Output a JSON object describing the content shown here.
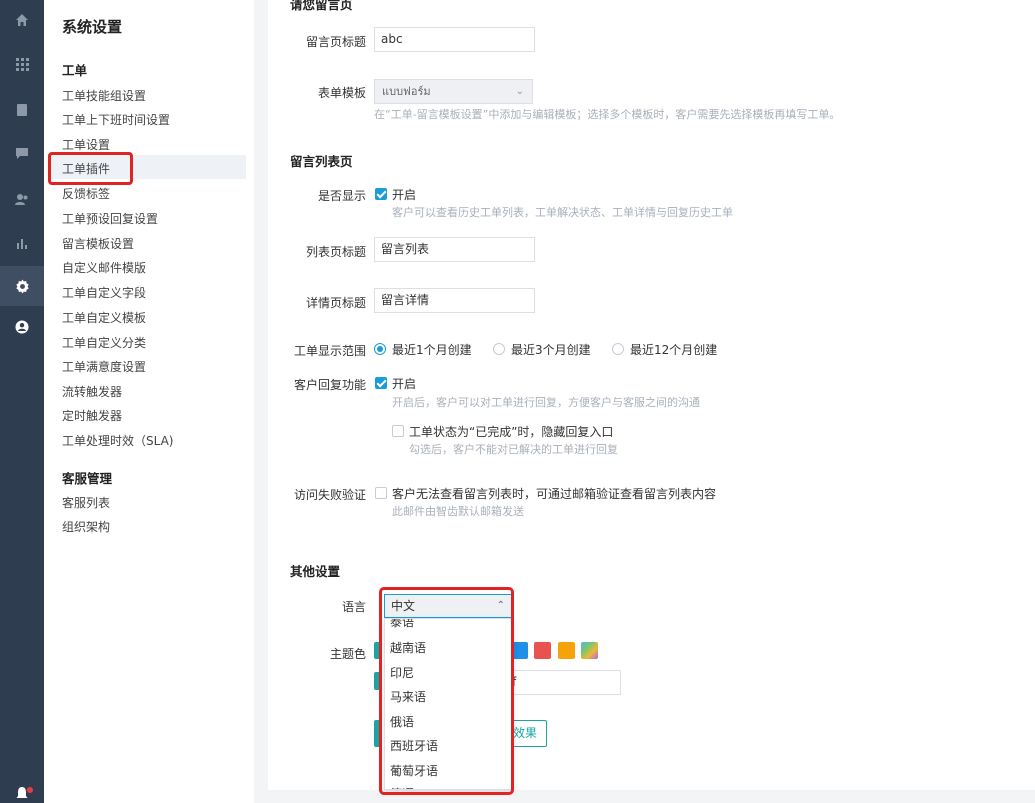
{
  "rail": {
    "icons": [
      "home-icon",
      "grid-icon",
      "document-icon",
      "chat-icon",
      "users-icon",
      "bar-chart-icon",
      "settings-icon",
      "account-icon"
    ],
    "active": "settings-icon"
  },
  "sidebar": {
    "title": "系统设置",
    "groups": [
      {
        "label": "工单",
        "items": [
          "工单技能组设置",
          "工单上下班时间设置",
          "工单设置",
          "工单插件",
          "反馈标签",
          "工单预设回复设置",
          "留言模板设置",
          "自定义邮件模版",
          "工单自定义字段",
          "工单自定义模板",
          "工单自定义分类",
          "工单满意度设置",
          "流转触发器",
          "定时触发器",
          "工单处理时效（SLA)"
        ]
      },
      {
        "label": "客服管理",
        "items": [
          "客服列表",
          "组织架构"
        ]
      }
    ],
    "active_item": "工单插件"
  },
  "page": {
    "section_top": "请您留言页",
    "title_label": "留言页标题",
    "title_value": "abc",
    "template_label": "表单模板",
    "template_value": "แบบฟอร์ม",
    "template_hint": "在“工单-留言模板设置”中添加与编辑模板；选择多个模板时，客户需要先选择模板再填写工单。",
    "list_section": "留言列表页",
    "show_label": "是否显示",
    "show_text": "开启",
    "show_hint": "客户可以查看历史工单列表，工单解决状态、工单详情与回复历史工单",
    "list_title_label": "列表页标题",
    "list_title_value": "留言列表",
    "detail_title_label": "详情页标题",
    "detail_title_value": "留言详情",
    "range_label": "工单显示范围",
    "range_options": [
      "最近1个月创建",
      "最近3个月创建",
      "最近12个月创建"
    ],
    "reply_label": "客户回复功能",
    "reply_text": "开启",
    "reply_hint": "开启后，客户可以对工单进行回复，方便客户与客服之间的沟通",
    "hide_text": "工单状态为“已完成”时，隐藏回复入口",
    "hide_hint": "勾选后，客户不能对已解决的工单进行回复",
    "verify_label": "访问失败验证",
    "verify_text": "客户无法查看留言列表时，可通过邮箱验证查看留言列表内容",
    "verify_hint": "此邮件由智齿默认邮箱发送",
    "other_section": "其他设置",
    "lang_label": "语言",
    "lang_value": "中文",
    "theme_label": "主题色",
    "theme_input_tail": "f",
    "effect_button": "效果",
    "swatch_colors": [
      "#1f8fe8",
      "#e8534f",
      "#f5a30a"
    ]
  },
  "dropdown": {
    "items": [
      "泰语",
      "越南语",
      "印尼",
      "马来语",
      "俄语",
      "西班牙语",
      "葡萄牙语",
      "德语"
    ]
  }
}
